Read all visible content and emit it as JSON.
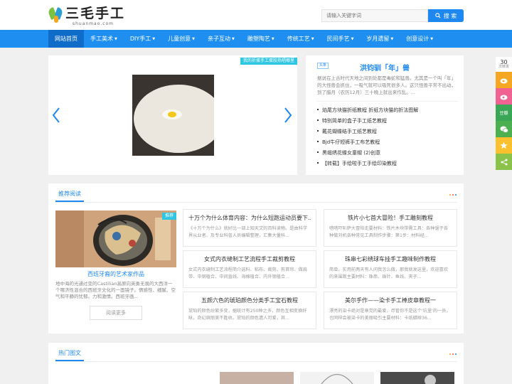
{
  "brand": {
    "name": "三毛手工",
    "domain_text": "shuanmao.com"
  },
  "search": {
    "placeholder": "请输入关键字词",
    "button": "搜 索"
  },
  "nav": [
    {
      "label": "网站首页",
      "dropdown": false,
      "active": true
    },
    {
      "label": "手工美术",
      "dropdown": true
    },
    {
      "label": "DIY手工",
      "dropdown": true
    },
    {
      "label": "儿童创意",
      "dropdown": true
    },
    {
      "label": "亲子互动",
      "dropdown": true
    },
    {
      "label": "雕塑陶艺",
      "dropdown": true
    },
    {
      "label": "传统工艺",
      "dropdown": true
    },
    {
      "label": "民间手艺",
      "dropdown": true
    },
    {
      "label": "岁月遗留",
      "dropdown": true
    },
    {
      "label": "创意设计",
      "dropdown": true
    }
  ],
  "slider": {
    "badge": "我的折蛋手工蛋胶热唱哪里"
  },
  "headline": {
    "tag": "头条",
    "title": "洪钧驯「年」兽",
    "desc": "据说在上古时代天地之间到处都是毒蛇和猛兽。尤其是一个叫「年」的大怪兽会抓住，一吸气就可以吸死很多人。这只怪兽平常不出动，到了腊月（农历12月）三十晚上就出来作乱。..."
  },
  "headline_list": [
    "焰尾方块猫折纸教程 折纸方块猫的折法图解",
    "特别简单的盒子手工纸艺教程",
    "戴花蝴蝶结手工纸艺教程",
    "Bjd牛仔短裤手工布艺教程",
    "黑缎绣花蝶女童帽 (2)创意",
    "【转载】手绘啦手工手绘印染教程"
  ],
  "recommend": {
    "title": "推荐阅读",
    "featured": {
      "badge": "推荐",
      "title": "西班牙裔的艺术家作品",
      "desc": "地中海的光通过变的Castilian高原向英勇无畏的大西洋一个哪济性混合的西班牙文化的一面镜子。情感性、细腻、空气和平静的忧郁。力和激情。西班牙画...",
      "more": "阅读更多"
    },
    "cards": [
      {
        "title": "十万个为什么体育内容：为什么短跑运动员要下...",
        "desc": "《十万个为什么》就好比一部上知天文的百科读物。是由科学界从业者、及专业科普人员编辑整理，汇集大量科..."
      },
      {
        "title": "铁片小七首大冒险！手工雕刻教程",
        "desc": "嗒嗒吓叭萨大冒险走要材料：铁片木块带需工具：各种锯子各种做刘机各种常见工具制作步骤：第1步：材料经..."
      },
      {
        "title": "女式内衣缝制工艺流程手工裁剪教程",
        "desc": "女式内衣缝制工艺流程简介选料、粘布、裁剪、剪首帘、做肩带、中钢植合、中间直线、海棉植合、内外钢植合..."
      },
      {
        "title": "珠串七彩绣球车挂手工趣味制作教程",
        "desc": "简单、实用前两天有人问我怎么做，那我就发这里，欢迎喜欢的来围观主要材料：珠串、珠针、鱼线、夹子..."
      },
      {
        "title": "五颜六色的琥珀颜色分类手工宝石教程",
        "desc": "琥珀的颜色纷繁多变，据统计有250种之多，颜色互相变换纤咏，奇幻缤丽美不胜收。琥珀的颜色遗人可爱，其..."
      },
      {
        "title": "美尔手作——染卡手工棒皮章教程一",
        "desc": "漂亮的染卡绝对是章党的最爱，尽管你不是这个'坑里'的一员，也同样会被染卡的美丽吸引主要材料：卡纸蜡辫36..."
      }
    ]
  },
  "hot": {
    "title": "热门图文"
  },
  "dots_colors": [
    "#f0a21c",
    "#ef5350",
    "#1e87f0"
  ],
  "float_share": {
    "count": "30",
    "count_label": "次转发",
    "douban": "豆瓣"
  },
  "colors": {
    "primary": "#1e87f0",
    "nav": "#1e8ff0",
    "badge": "#2ec6e0"
  }
}
